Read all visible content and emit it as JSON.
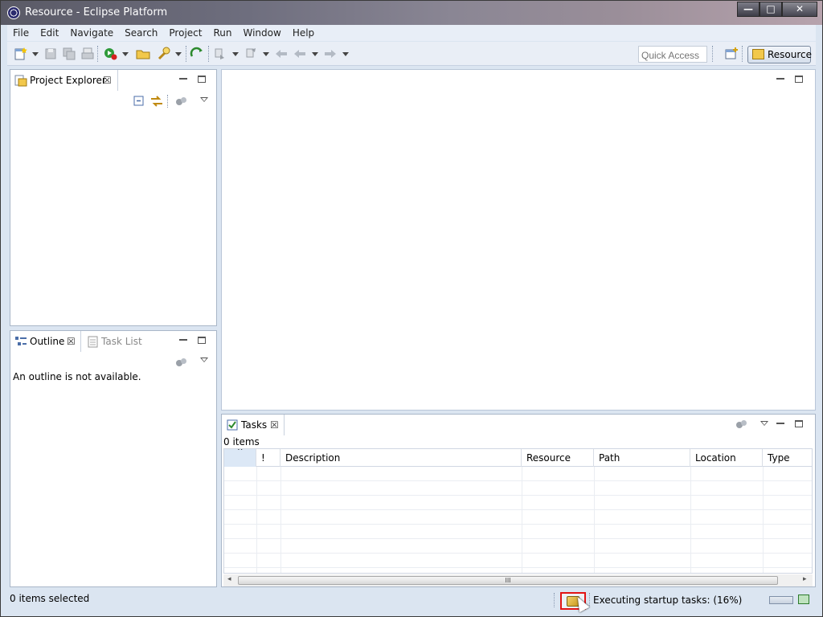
{
  "window": {
    "title": "Resource - Eclipse Platform",
    "controls": {
      "minimize": "—",
      "maximize": "□",
      "close": "✕"
    }
  },
  "menubar": {
    "items": [
      "File",
      "Edit",
      "Navigate",
      "Search",
      "Project",
      "Run",
      "Window",
      "Help"
    ]
  },
  "toolbar": {
    "quick_access_placeholder": "Quick Access",
    "perspective_label": "Resource"
  },
  "project_explorer": {
    "tab_label": "Project Explorer"
  },
  "outline": {
    "tabs": [
      "Outline",
      "Task List"
    ],
    "message": "An outline is not available."
  },
  "tasks": {
    "tab_label": "Tasks",
    "count_text": "0 items",
    "columns": [
      "",
      "!",
      "Description",
      "Resource",
      "Path",
      "Location",
      "Type"
    ],
    "scroll_grip": "III"
  },
  "statusbar": {
    "selection_text": "0 items selected",
    "task_text": "Executing startup tasks: (16%)",
    "progress_percent": 16
  },
  "colors": {
    "accent_highlight": "#e21414",
    "workbench_bg": "#dbe5f1"
  },
  "icons": [
    "app-icon",
    "new-icon",
    "save-icon",
    "save-all-icon",
    "print-icon",
    "run-icon",
    "open-icon",
    "search-icon",
    "back-icon",
    "forward-icon",
    "collapse-all-icon",
    "link-editor-icon",
    "gears-icon",
    "view-menu-icon",
    "minimize-icon",
    "maximize-icon",
    "close-icon",
    "progress-icon"
  ]
}
